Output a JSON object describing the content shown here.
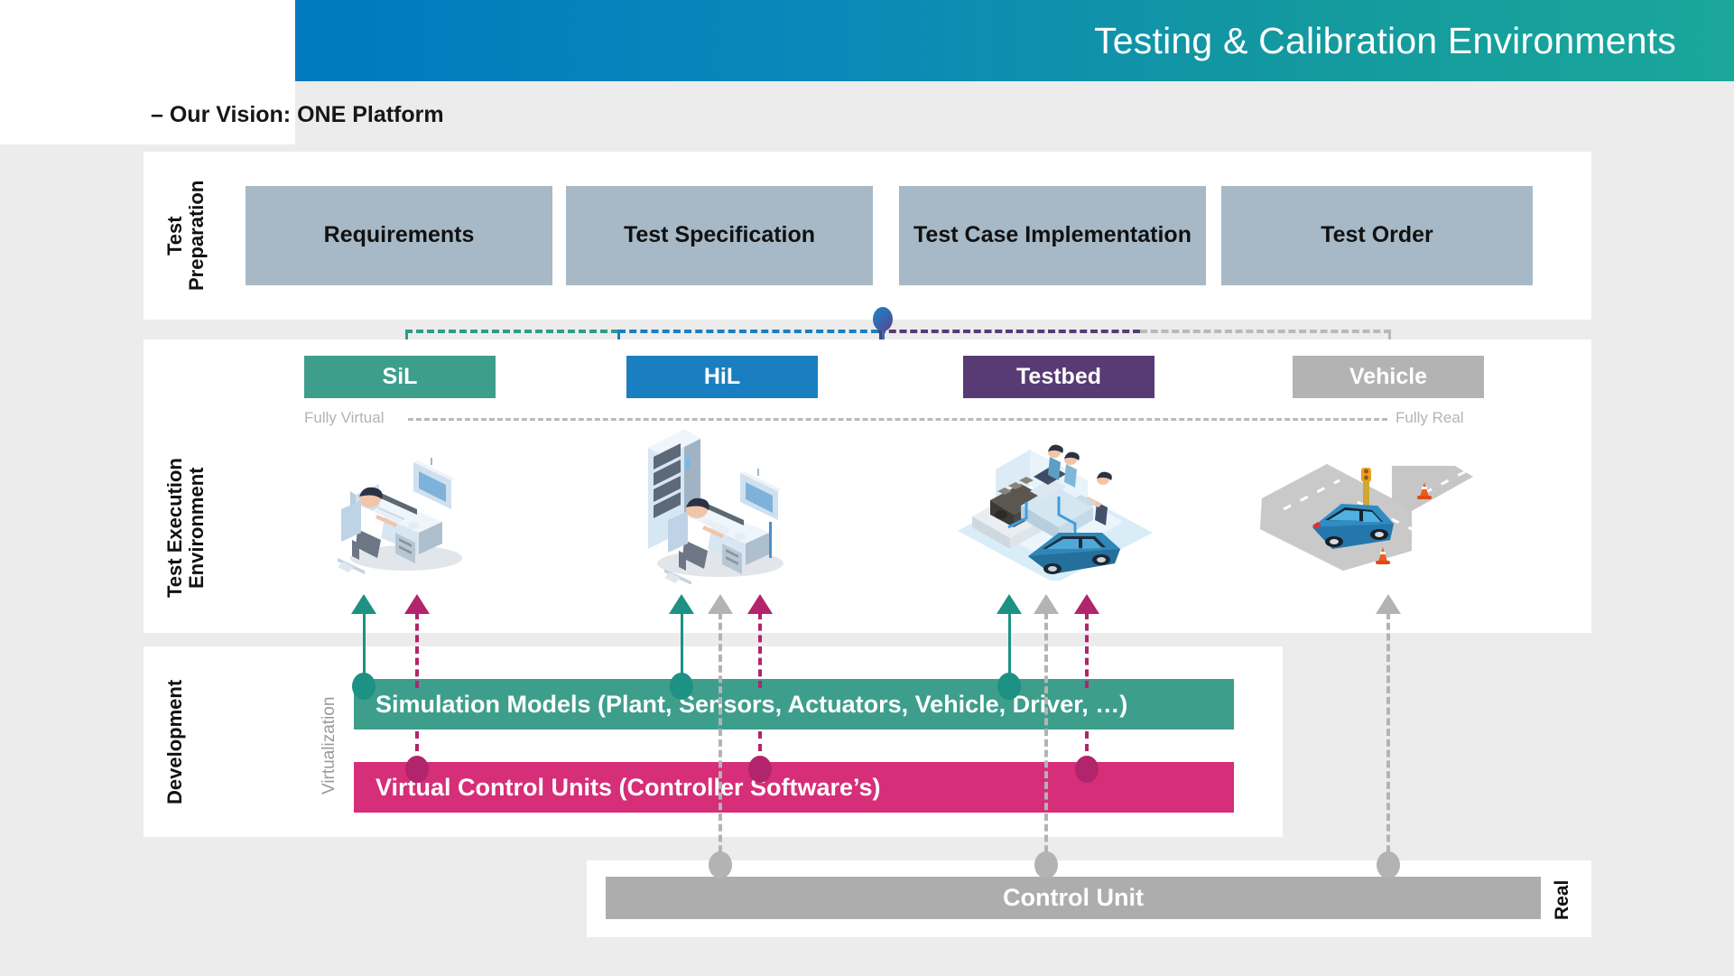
{
  "header": {
    "title": "Testing & Calibration Environments",
    "subtitle": "– Our Vision: ONE Platform",
    "gradient_from": "#0079be",
    "gradient_to": "#1aa79a"
  },
  "sections": {
    "preparation": {
      "label": "Test\nPreparation",
      "box_color": "#a7b9c6",
      "boxes": [
        {
          "label": "Requirements"
        },
        {
          "label": "Test Specification"
        },
        {
          "label": "Test Case\nImplementation"
        },
        {
          "label": "Test Order"
        }
      ]
    },
    "execution": {
      "label": "Test Execution\nEnvironment",
      "tabs": [
        {
          "label": "SiL",
          "color": "#3d9e8c",
          "illustration": "workstation-desk-icon"
        },
        {
          "label": "HiL",
          "color": "#1a7fc1",
          "illustration": "server-rack-desk-icon"
        },
        {
          "label": "Testbed",
          "color": "#583b75",
          "illustration": "engine-testbed-icon"
        },
        {
          "label": "Vehicle",
          "color": "#b3b3b3",
          "illustration": "car-on-road-icon"
        }
      ],
      "scale_left": "Fully Virtual",
      "scale_right": "Fully Real"
    },
    "development": {
      "label": "Development",
      "axis_label": "Virtualization",
      "bars": [
        {
          "label": "Simulation Models (Plant, Sensors, Actuators, Vehicle, Driver, …)",
          "color": "#3d9e8c"
        },
        {
          "label": "Virtual Control Units (Controller Software’s)",
          "color": "#d62e78"
        }
      ]
    },
    "real": {
      "label": "Real",
      "bar": {
        "label": "Control Unit",
        "color": "#adadad"
      }
    }
  },
  "flows": {
    "simulation_color": "#1d9183",
    "vcu_color": "#b2246b",
    "real_color": "#b3b3b3"
  }
}
